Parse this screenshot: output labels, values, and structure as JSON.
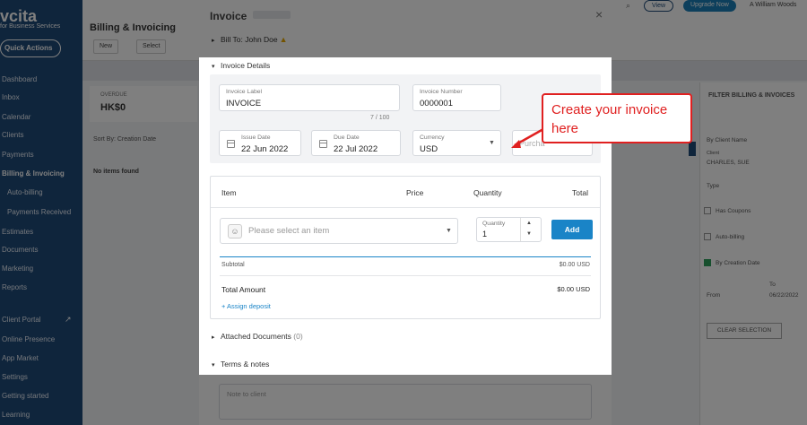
{
  "app": {
    "brand": "vcita",
    "brand_sub": "for Business Services",
    "quick_actions": "Quick Actions",
    "top_pill_1": "View",
    "top_pill_2": "Upgrade Now",
    "top_user": "A William Woods"
  },
  "sidebar": {
    "items": [
      {
        "label": "Dashboard"
      },
      {
        "label": "Inbox"
      },
      {
        "label": "Calendar"
      },
      {
        "label": "Clients"
      },
      {
        "label": "Payments"
      },
      {
        "label": "Billing & Invoicing"
      },
      {
        "label": "Auto-billing"
      },
      {
        "label": "Payments Received"
      },
      {
        "label": "Estimates"
      },
      {
        "label": "Documents"
      },
      {
        "label": "Marketing"
      },
      {
        "label": "Reports"
      },
      {
        "label": "Client Portal"
      },
      {
        "label": "Online Presence"
      },
      {
        "label": "App Market"
      },
      {
        "label": "Settings"
      },
      {
        "label": "Getting started"
      },
      {
        "label": "Learning"
      }
    ]
  },
  "background": {
    "page_title": "Billing & Invoicing",
    "btn_new": "New",
    "btn_select": "Select",
    "card_label": "OVERDUE",
    "card_value": "HK$0",
    "sort_by": "Sort By:  Creation Date",
    "no_items": "No items found"
  },
  "filter": {
    "title": "FILTER BILLING & INVOICES",
    "by_client_label": "By Client Name",
    "client_label": "Client",
    "client_value": "CHARLES, SUE",
    "type_label": "Type",
    "has_coupons": "Has Coupons",
    "auto_billing": "Auto-billing",
    "by_creation_date": "By Creation Date",
    "from_label": "From",
    "to_label": "To",
    "date_value": "06/22/2022",
    "clear_btn": "CLEAR SELECTION"
  },
  "modal": {
    "title": "Invoice",
    "bill_to": "Bill To: John Doe",
    "invoice_details": "Invoice Details",
    "invoice_label_label": "Invoice Label",
    "invoice_label_value": "INVOICE",
    "invoice_number_label": "Invoice Number",
    "invoice_number_value": "0000001",
    "char_counter": "7 / 100",
    "issue_date_label": "Issue Date",
    "issue_date_value": "22 Jun 2022",
    "due_date_label": "Due Date",
    "due_date_value": "22 Jul 2022",
    "currency_label": "Currency",
    "currency_value": "USD",
    "purchase_partial": "Purcha",
    "items": {
      "col_item": "Item",
      "col_price": "Price",
      "col_quantity": "Quantity",
      "col_total": "Total",
      "select_placeholder": "Please select an item",
      "qty_label": "Quantity",
      "qty_value": "1",
      "add_label": "Add",
      "subtotal_label": "Subtotal",
      "subtotal_value": "$0.00 USD",
      "total_label": "Total Amount",
      "total_value": "$0.00 USD",
      "assign_deposit": "+  Assign deposit"
    },
    "attached_documents": "Attached Documents",
    "attached_count": "(0)",
    "terms_notes": "Terms & notes",
    "notes_placeholder": "Note to client"
  },
  "annotation": {
    "text": "Create your invoice here",
    "color": "#e02020"
  },
  "colors": {
    "sidebar": "#1f4a78",
    "accent": "#1a84c7"
  }
}
